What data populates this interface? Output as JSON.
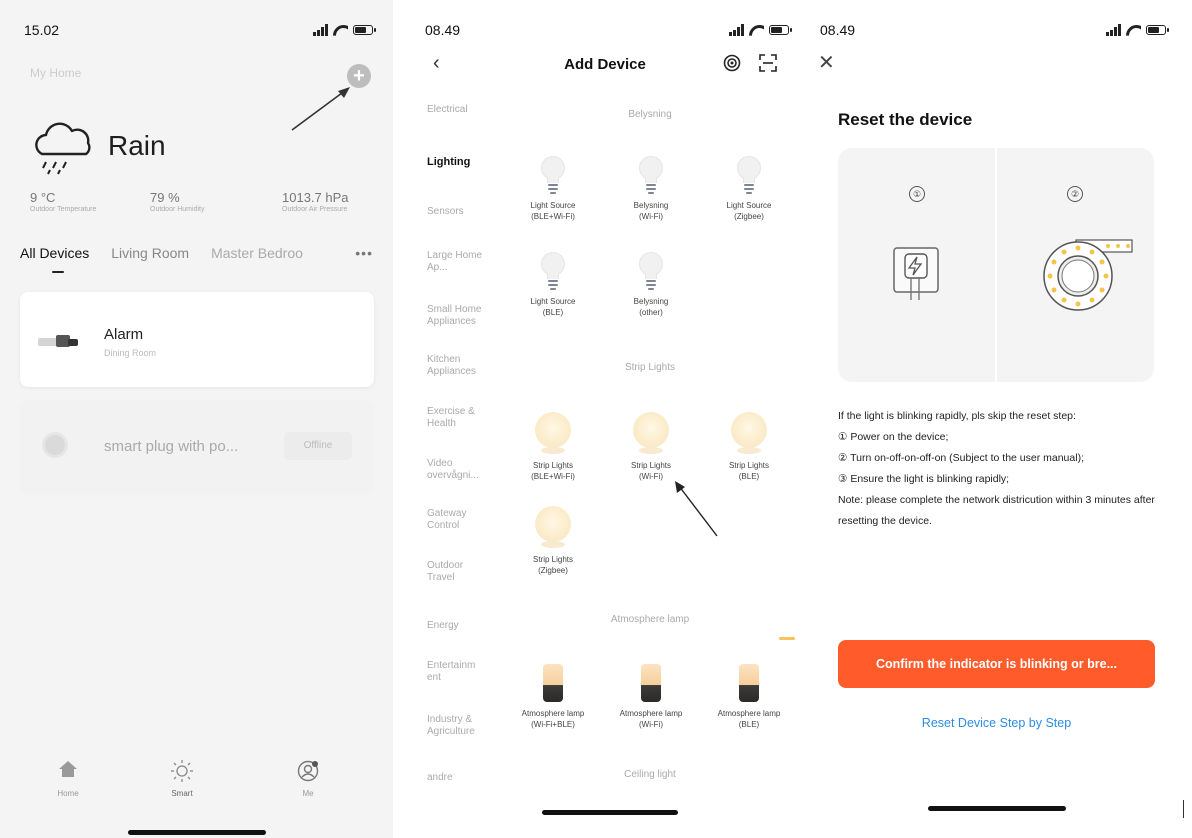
{
  "home": {
    "status_time": "15.02",
    "home_name": "My Home",
    "weather": {
      "condition": "Rain"
    },
    "stats": [
      {
        "value": "9 °C",
        "label": "Outdoor Temperature"
      },
      {
        "value": "79 %",
        "label": "Outdoor Humidity"
      },
      {
        "value": "1013.7 hPa",
        "label": "Outdoor Air Pressure"
      }
    ],
    "tabs": [
      "All Devices",
      "Living Room",
      "Master Bedroo"
    ],
    "more": "•••",
    "devices": [
      {
        "name": "Alarm",
        "room": "Dining Room"
      },
      {
        "name": "smart plug with po...",
        "status": "Offline"
      }
    ],
    "tabbar": [
      "Home",
      "Smart",
      "Me"
    ]
  },
  "add_device": {
    "status_time": "08.49",
    "title": "Add Device",
    "categories": [
      "Electrical",
      "Lighting",
      "Sensors",
      "Large Home Ap...",
      "Small Home Appliances",
      "Kitchen Appliances",
      "Exercise & Health",
      "Video overvågni...",
      "Gateway Control",
      "Outdoor Travel",
      "Energy",
      "Entertainm ent",
      "Industry & Agriculture",
      "andre"
    ],
    "sections": {
      "belysning": "Belysning",
      "strip": "Strip Lights",
      "atmosphere": "Atmosphere lamp",
      "ceiling": "Ceiling light"
    },
    "bulbs": [
      {
        "l1": "Light Source",
        "l2": "(BLE+Wi-Fi)"
      },
      {
        "l1": "Belysning",
        "l2": "(Wi-Fi)"
      },
      {
        "l1": "Light Source",
        "l2": "(Zigbee)"
      },
      {
        "l1": "Light Source",
        "l2": "(BLE)"
      },
      {
        "l1": "Belysning",
        "l2": "(other)"
      }
    ],
    "strips": [
      {
        "l1": "Strip Lights",
        "l2": "(BLE+Wi-Fi)"
      },
      {
        "l1": "Strip Lights",
        "l2": "(Wi-Fi)"
      },
      {
        "l1": "Strip Lights",
        "l2": "(BLE)"
      },
      {
        "l1": "Strip Lights",
        "l2": "(Zigbee)"
      }
    ],
    "atmos": [
      {
        "l1": "Atmosphere lamp",
        "l2": "(Wi-Fi+BLE)"
      },
      {
        "l1": "Atmosphere lamp",
        "l2": "(Wi-Fi)"
      },
      {
        "l1": "Atmosphere lamp",
        "l2": "(BLE)"
      }
    ]
  },
  "reset": {
    "status_time": "08.49",
    "title": "Reset the device",
    "step1": "①",
    "step2": "②",
    "instructions": [
      "If the light is blinking rapidly, pls skip the reset step:",
      "① Power on the device;",
      "② Turn on-off-on-off-on (Subject to the user manual);",
      "③ Ensure the light is blinking rapidly;",
      "Note: please complete the network districution within 3 minutes after resetting the device."
    ],
    "confirm_label": "Confirm the indicator is blinking or bre...",
    "link_label": "Reset Device Step by Step",
    "accent": "#ff5b2b",
    "link_color": "#2d8ce6"
  }
}
